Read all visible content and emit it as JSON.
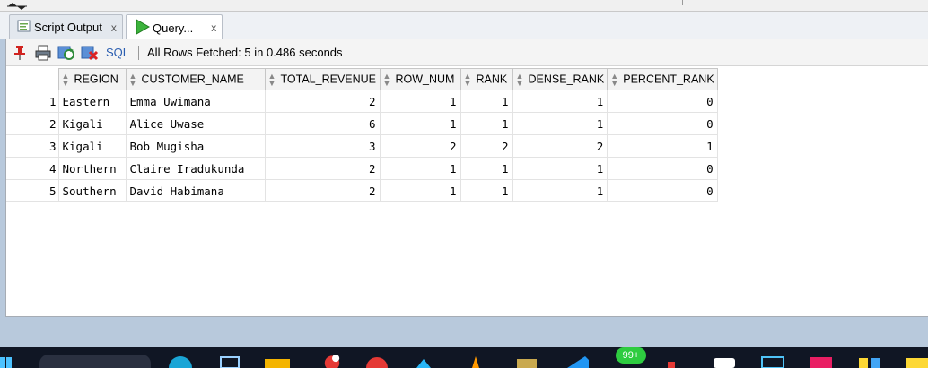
{
  "tabs": [
    {
      "label": "Script Output",
      "close": "x"
    },
    {
      "label": "Query...",
      "close": "x"
    }
  ],
  "toolbar": {
    "sql_label": "SQL",
    "status": "All Rows Fetched: 5 in 0.486 seconds"
  },
  "grid": {
    "columns": [
      "REGION",
      "CUSTOMER_NAME",
      "TOTAL_REVENUE",
      "ROW_NUM",
      "RANK",
      "DENSE_RANK",
      "PERCENT_RANK"
    ],
    "rows": [
      {
        "n": "1",
        "region": "Eastern",
        "customer": "Emma Uwimana",
        "revenue": "2",
        "row_num": "1",
        "rank": "1",
        "dense_rank": "1",
        "percent_rank": "0"
      },
      {
        "n": "2",
        "region": "Kigali",
        "customer": "Alice Uwase",
        "revenue": "6",
        "row_num": "1",
        "rank": "1",
        "dense_rank": "1",
        "percent_rank": "0"
      },
      {
        "n": "3",
        "region": "Kigali",
        "customer": "Bob Mugisha",
        "revenue": "3",
        "row_num": "2",
        "rank": "2",
        "dense_rank": "2",
        "percent_rank": "1"
      },
      {
        "n": "4",
        "region": "Northern",
        "customer": "Claire Iradukunda",
        "revenue": "2",
        "row_num": "1",
        "rank": "1",
        "dense_rank": "1",
        "percent_rank": "0"
      },
      {
        "n": "5",
        "region": "Southern",
        "customer": "David Habimana",
        "revenue": "2",
        "row_num": "1",
        "rank": "1",
        "dense_rank": "1",
        "percent_rank": "0"
      }
    ]
  },
  "taskbar": {
    "badge": "99+"
  }
}
